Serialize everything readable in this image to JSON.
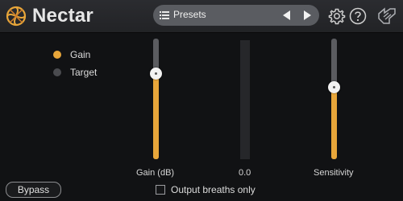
{
  "app": {
    "title": "Nectar",
    "logo": "nectar-swirl-logo"
  },
  "presets": {
    "label": "Presets",
    "menu_icon": "list-menu-icon",
    "prev_icon": "triangle-left-icon",
    "next_icon": "triangle-right-icon"
  },
  "header_icons": [
    "gear-icon",
    "help-icon",
    "izotope-logo-icon"
  ],
  "mode": {
    "items": [
      {
        "label": "Gain",
        "selected": true
      },
      {
        "label": "Target",
        "selected": false
      }
    ]
  },
  "gain_slider": {
    "label": "Gain (dB)",
    "level": 0.71
  },
  "meter": {
    "value": "0.0",
    "level": 0.0
  },
  "sensitivity_slider": {
    "label": "Sensitivity",
    "level": 0.6
  },
  "bypass": {
    "label": "Bypass"
  },
  "output_breaths": {
    "label": "Output breaths only",
    "checked": false
  },
  "colors": {
    "accent": "#e8a63a",
    "background": "#111214",
    "header": "#252629",
    "track": "#5b5c60"
  }
}
